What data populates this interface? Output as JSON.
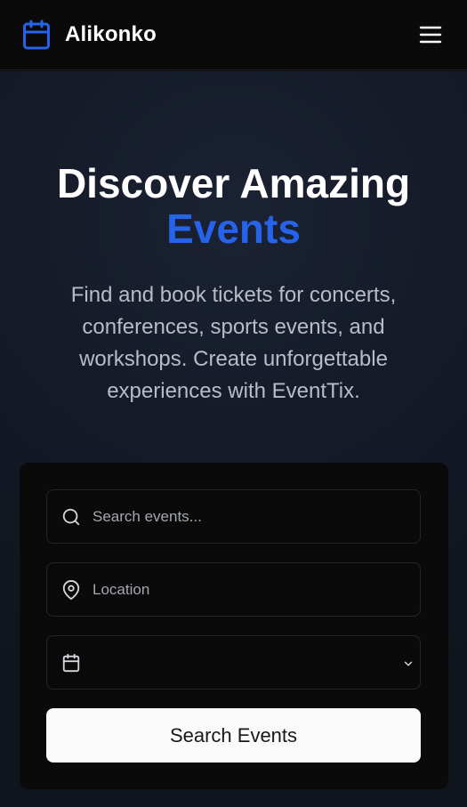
{
  "header": {
    "brand_name": "Alikonko",
    "brand_icon": "calendar-icon",
    "menu_icon": "hamburger-menu-icon",
    "brand_color": "#2563eb"
  },
  "hero": {
    "title_line1": "Discover Amazing",
    "title_accent": "Events",
    "subtitle": "Find and book tickets for concerts, conferences, sports events, and workshops. Create unforgettable experiences with EventTix."
  },
  "search_form": {
    "search_placeholder": "Search events...",
    "search_value": "",
    "search_icon": "search-icon",
    "location_placeholder": "Location",
    "location_value": "",
    "location_icon": "map-pin-icon",
    "date_value": "",
    "date_icon": "calendar-icon",
    "date_chevron_icon": "chevron-down-icon",
    "submit_label": "Search Events"
  }
}
